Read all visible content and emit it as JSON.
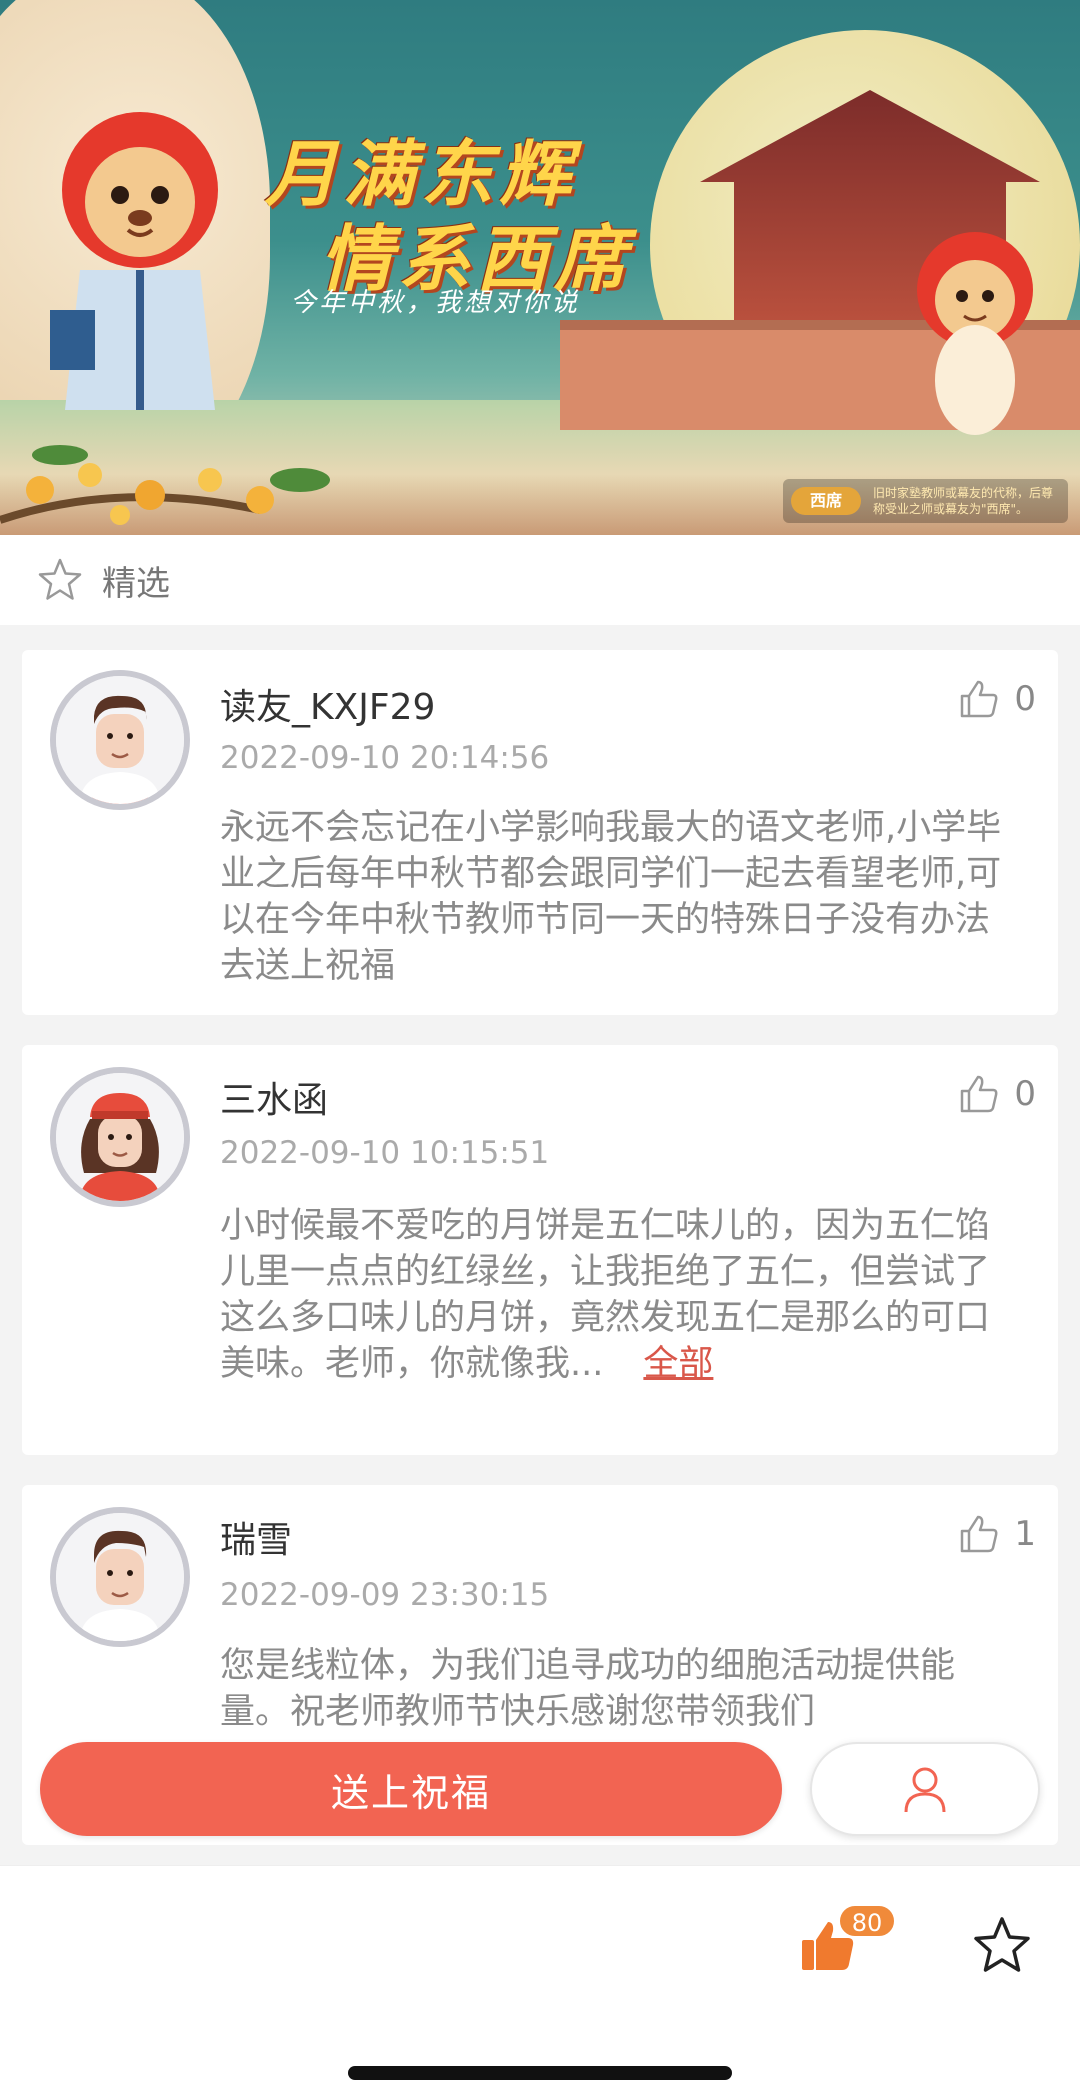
{
  "banner": {
    "title_line1": "月满东辉",
    "title_line2": "情系西席",
    "subtitle": "今年中秋，我想对你说",
    "footnote_tag": "西席",
    "footnote_text": "旧时家塾教师或幕友的代称，后尊称受业之师或幕友为\"西席\"。"
  },
  "section": {
    "label": "精选"
  },
  "comments": [
    {
      "name": "读友_KXJF29",
      "time": "2022-09-10 20:14:56",
      "likes": "0",
      "content": "永远不会忘记在小学影响我最大的语文老师,小学毕业之后每年中秋节都会跟同学们一起去看望老师,可以在今年中秋节教师节同一天的特殊日子没有办法去送上祝福"
    },
    {
      "name": "三水函",
      "time": "2022-09-10 10:15:51",
      "likes": "0",
      "content": "小时候最不爱吃的月饼是五仁味儿的，因为五仁馅儿里一点点的红绿丝，让我拒绝了五仁，但尝试了这么多口味儿的月饼，竟然发现五仁是那么的可口美味。老师，你就像我...",
      "more_label": "全部"
    },
    {
      "name": "瑞雪",
      "time": "2022-09-09 23:30:15",
      "likes": "1",
      "content": "您是线粒体，为我们追寻成功的细胞活动提供能量。祝老师教师节快乐感谢您带领我们"
    }
  ],
  "actions": {
    "send_label": "送上祝福"
  },
  "bottom_bar": {
    "like_badge": "80"
  },
  "colors": {
    "accent": "#f26452",
    "badge": "#f08a3a"
  }
}
